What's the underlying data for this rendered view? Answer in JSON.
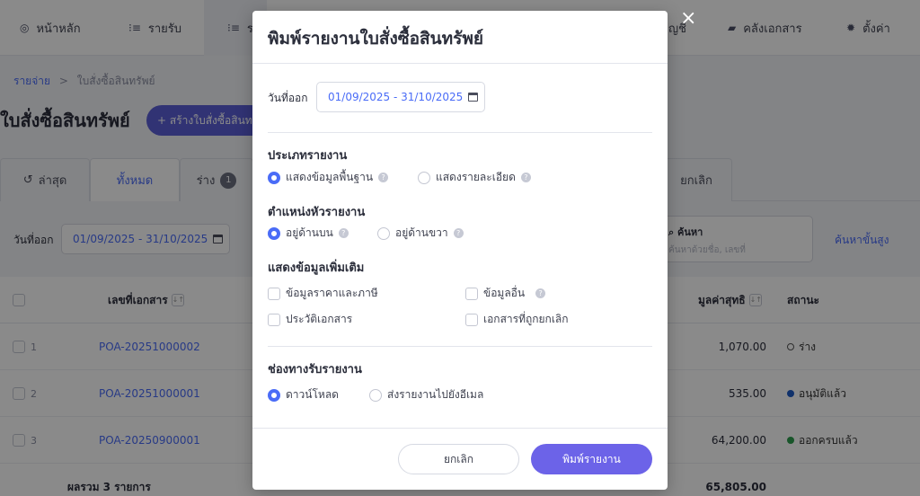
{
  "nav": {
    "home": "หน้าหลัก",
    "income": "รายรับ",
    "expense": "ร",
    "accounting": "ญชี",
    "documents": "คลังเอกสาร",
    "settings": "ตั้งค่า"
  },
  "breadcrumb": {
    "parent": "รายจ่าย",
    "separator": ">",
    "current": "ใบสั่งซื้อสินทรัพย์"
  },
  "page": {
    "title": "ใบสั่งซื้อสินทรัพย์",
    "create_label": "+ สร้างใบสั่งซื้อสินทรัพย์"
  },
  "tabs": {
    "latest": "ล่าสุด",
    "all": "ทั้งหมด",
    "draft": "ร่าง",
    "draft_count": "1",
    "cancelled": "ยกเลิก"
  },
  "filters": {
    "date_label": "วันที่ออก",
    "date_value": "01/09/2025 - 31/10/2025",
    "search_label": "ค้นหา",
    "search_placeholder": "ค้นหาด้วยชื่อ, เลขที่",
    "advanced_search": "ค้นหาขั้นสูง"
  },
  "table": {
    "headers": {
      "doc_no": "เลขที่เอกสาร",
      "net": "มูลค่าสุทธิ",
      "status": "สถานะ"
    },
    "rows": [
      {
        "num": "1",
        "doc_no": "POA-20251000002",
        "net": "1,070.00",
        "status": "ร่าง",
        "status_color": "#555555"
      },
      {
        "num": "2",
        "doc_no": "POA-20251000001",
        "net": "535.00",
        "status": "อนุมัติแล้ว",
        "status_color": "#1e5bc6"
      },
      {
        "num": "3",
        "doc_no": "POA-20250900001",
        "net": "64,200.00",
        "status": "ออกครบแล้ว",
        "status_color": "#2e9e4f"
      }
    ],
    "total_label": "ผลรวม 3 รายการ",
    "total_value": "65,805.00"
  },
  "modal": {
    "close": "×",
    "title": "พิมพ์รายงานใบสั่งซื้อสินทรัพย์",
    "date_label": "วันที่ออก",
    "date_value": "01/09/2025 - 31/10/2025",
    "report_type": {
      "title": "ประเภทรายงาน",
      "options": [
        "แสดงข้อมูลพื้นฐาน",
        "แสดงรายละเอียด"
      ],
      "selected": "แสดงข้อมูลพื้นฐาน"
    },
    "header_position": {
      "title": "ตำแหน่งหัวรายงาน",
      "options": [
        "อยู่ด้านบน",
        "อยู่ด้านขวา"
      ],
      "selected": "อยู่ด้านบน"
    },
    "extra_info": {
      "title": "แสดงข้อมูลเพิ่มเติม",
      "options": [
        "ข้อมูลราคาและภาษี",
        "ข้อมูลอื่น",
        "ประวัติเอกสาร",
        "เอกสารที่ถูกยกเลิก"
      ]
    },
    "channel": {
      "title": "ช่องทางรับรายงาน",
      "options": [
        "ดาวน์โหลด",
        "ส่งรายงานไปยังอีเมล"
      ],
      "selected": "ดาวน์โหลด"
    },
    "cancel_label": "ยกเลิก",
    "print_label": "พิมพ์รายงาน"
  },
  "colors": {
    "accent": "#4a6cf7",
    "primary_button": "#6c63e8"
  }
}
